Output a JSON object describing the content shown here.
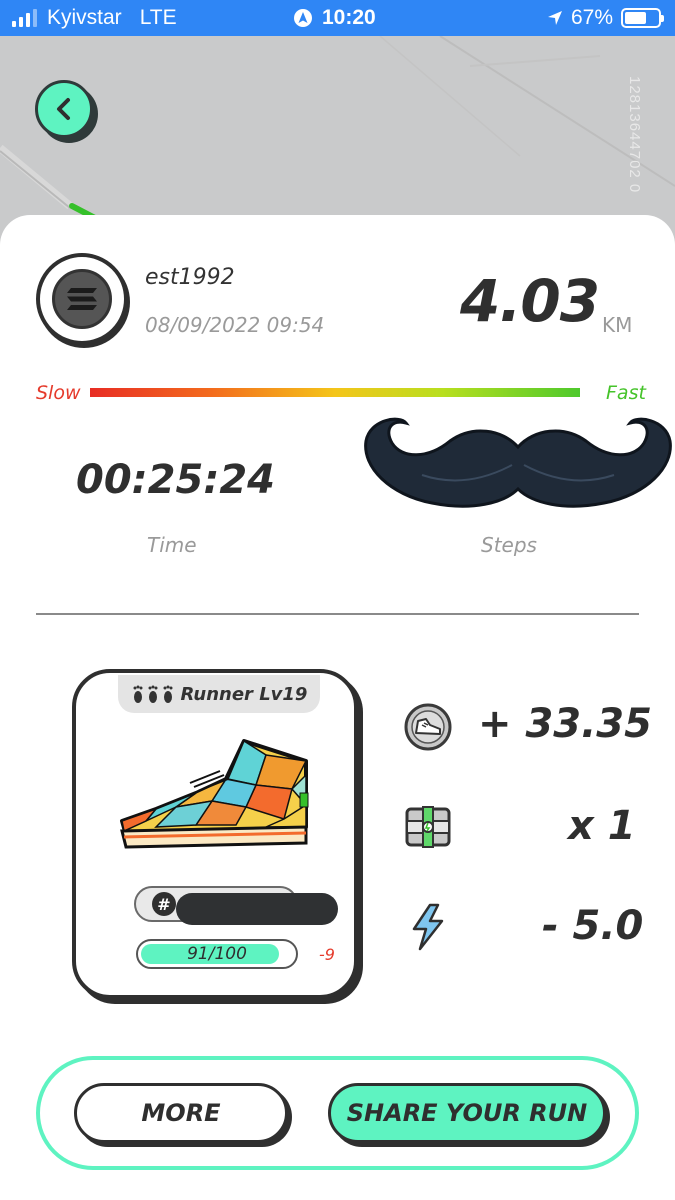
{
  "status_bar": {
    "carrier": "Kyivstar",
    "network": "LTE",
    "time": "10:20",
    "battery": "67%",
    "battery_level": 0.67
  },
  "map": {
    "id_text": "12813644702 0"
  },
  "run": {
    "username": "est1992",
    "datetime": "08/09/2022 09:54",
    "distance": "4.03",
    "distance_unit": "KM",
    "speed_slow_label": "Slow",
    "speed_fast_label": "Fast",
    "time": "00:25:24",
    "time_label": "Time",
    "steps_label": "Steps"
  },
  "sneaker": {
    "title": "Runner Lv19",
    "id_hash": "#",
    "durability_text": "91/100",
    "durability_level": 0.91,
    "durability_delta": "-9"
  },
  "rewards": {
    "gst_value": "+ 33.35",
    "gst_icon": "sneaker-coin-icon",
    "box_value": "x 1",
    "box_icon": "mystery-box-icon",
    "energy_value": "- 5.0",
    "energy_icon": "lightning-icon"
  },
  "buttons": {
    "more_label": "MORE",
    "share_label": "SHARE YOUR RUN"
  },
  "colors": {
    "accent": "#5ef3c1",
    "status_bar": "#2f86f5",
    "dark": "#2f2f2f",
    "slow": "#e53b2c",
    "fast": "#45c32a"
  }
}
